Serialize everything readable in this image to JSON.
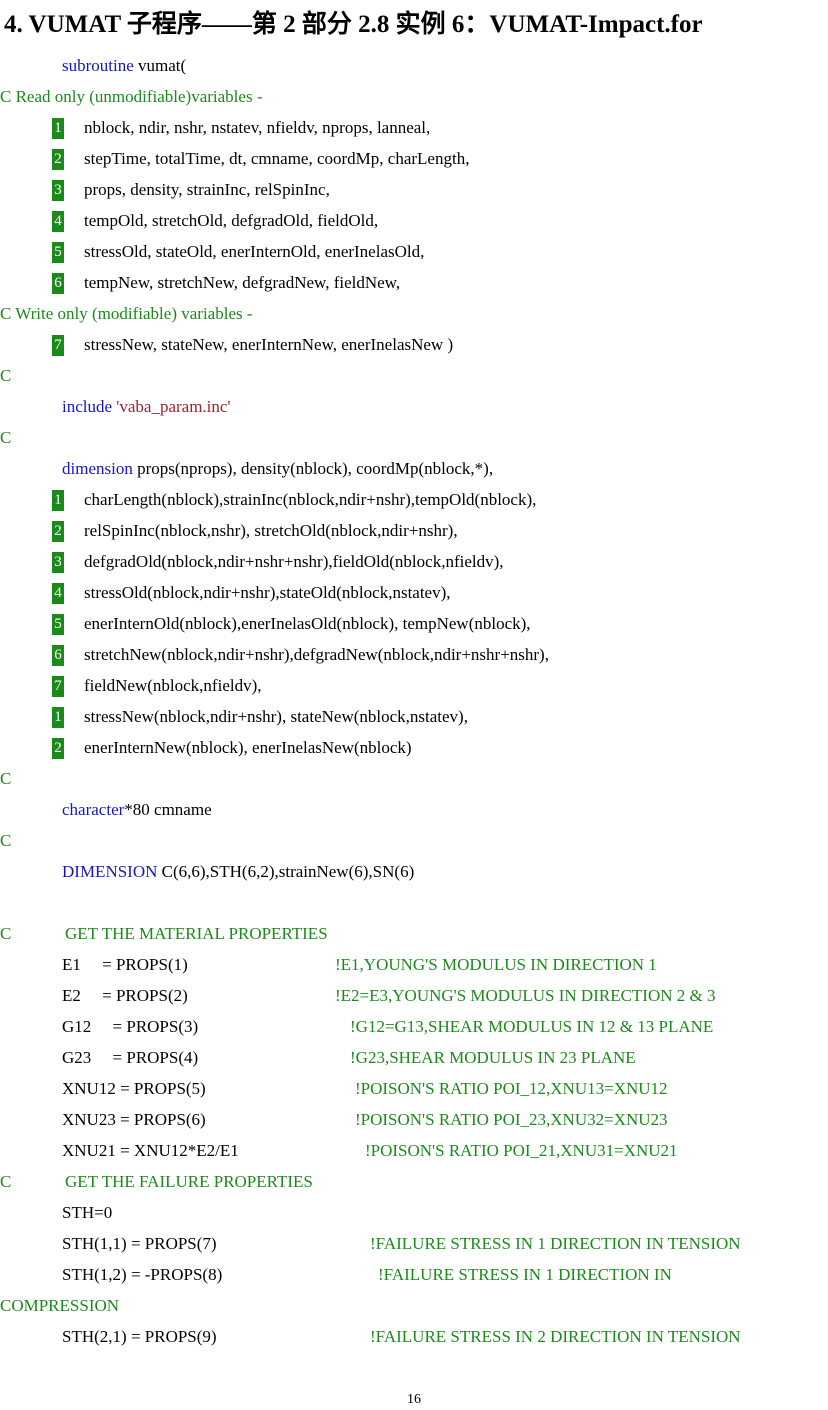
{
  "title": "4. VUMAT 子程序——第 2 部分 2.8 实例 6：VUMAT-Impact.for",
  "lines": {
    "l01": {
      "kw": "subroutine",
      "rest": " vumat("
    },
    "l02": {
      "cm": "C Read only (unmodifiable)variables -"
    },
    "l03": {
      "n": "1",
      "code": "nblock, ndir, nshr, nstatev, nfieldv, nprops, lanneal,"
    },
    "l04": {
      "n": "2",
      "code": "stepTime, totalTime, dt, cmname, coordMp, charLength,"
    },
    "l05": {
      "n": "3",
      "code": "props, density, strainInc, relSpinInc,"
    },
    "l06": {
      "n": "4",
      "code": "tempOld, stretchOld, defgradOld, fieldOld,"
    },
    "l07": {
      "n": "5",
      "code": "stressOld, stateOld, enerInternOld, enerInelasOld,"
    },
    "l08": {
      "n": "6",
      "code": "tempNew, stretchNew, defgradNew, fieldNew,"
    },
    "l09": {
      "cm": "C Write only (modifiable) variables -"
    },
    "l10": {
      "n": "7",
      "code": "stressNew, stateNew, enerInternNew, enerInelasNew )"
    },
    "l11": {
      "c": "C"
    },
    "l12": {
      "kw": "include",
      "str": " 'vaba_param.inc'"
    },
    "l13": {
      "c": "C"
    },
    "l14": {
      "kw": "dimension",
      "rest": " props(nprops), density(nblock), coordMp(nblock,*),"
    },
    "l15": {
      "n": "1",
      "code": "charLength(nblock),strainInc(nblock,ndir+nshr),tempOld(nblock),"
    },
    "l16": {
      "n": "2",
      "code": "relSpinInc(nblock,nshr), stretchOld(nblock,ndir+nshr),"
    },
    "l17": {
      "n": "3",
      "code": "defgradOld(nblock,ndir+nshr+nshr),fieldOld(nblock,nfieldv),"
    },
    "l18": {
      "n": "4",
      "code": "stressOld(nblock,ndir+nshr),stateOld(nblock,nstatev),"
    },
    "l19": {
      "n": "5",
      "code": "enerInternOld(nblock),enerInelasOld(nblock), tempNew(nblock),"
    },
    "l20": {
      "n": "6",
      "code": "stretchNew(nblock,ndir+nshr),defgradNew(nblock,ndir+nshr+nshr),"
    },
    "l21": {
      "n": "7",
      "code": "fieldNew(nblock,nfieldv),"
    },
    "l22": {
      "n": "1",
      "code": "stressNew(nblock,ndir+nshr), stateNew(nblock,nstatev),"
    },
    "l23": {
      "n": "2",
      "code": "enerInternNew(nblock), enerInelasNew(nblock)"
    },
    "l24": {
      "c": "C"
    },
    "l25": {
      "kw": "character",
      "rest": "*80 cmname"
    },
    "l26": {
      "c": "C"
    },
    "l27": {
      "kw": "DIMENSION",
      "rest": " C(6,6),STH(6,2),strainNew(6),SN(6)"
    },
    "l28": {
      "c": "C",
      "cm": "GET THE MATERIAL PROPERTIES"
    },
    "l29": {
      "code": "E1     = PROPS(1)",
      "cm": "!E1,YOUNG'S MODULUS IN DIRECTION 1"
    },
    "l30": {
      "code": "E2     = PROPS(2)",
      "cm": "!E2=E3,YOUNG'S MODULUS IN DIRECTION 2 & 3"
    },
    "l31": {
      "code": "G12     = PROPS(3)",
      "cm": "!G12=G13,SHEAR MODULUS IN 12 & 13 PLANE"
    },
    "l32": {
      "code": "G23     = PROPS(4)",
      "cm": "!G23,SHEAR MODULUS IN 23 PLANE"
    },
    "l33": {
      "code": "XNU12 = PROPS(5)",
      "cm": "!POISON'S RATIO POI_12,XNU13=XNU12"
    },
    "l34": {
      "code": "XNU23 = PROPS(6)",
      "cm": "!POISON'S RATIO POI_23,XNU32=XNU23"
    },
    "l35": {
      "code": "XNU21 = XNU12*E2/E1",
      "cm": "!POISON'S RATIO POI_21,XNU31=XNU21"
    },
    "l36": {
      "c": "C",
      "cm": "GET THE FAILURE PROPERTIES"
    },
    "l37": {
      "code": "STH=0"
    },
    "l38": {
      "code": "STH(1,1) = PROPS(7)",
      "cm": "!FAILURE STRESS IN 1 DIRECTION IN TENSION"
    },
    "l39": {
      "code": "STH(1,2) = -PROPS(8)",
      "cm": "!FAILURE STRESS IN 1 DIRECTION IN"
    },
    "l40": {
      "cm": "COMPRESSION"
    },
    "l41": {
      "code": "STH(2,1) = PROPS(9)",
      "cm": "!FAILURE STRESS IN 2 DIRECTION IN TENSION"
    }
  },
  "page_number": "16"
}
